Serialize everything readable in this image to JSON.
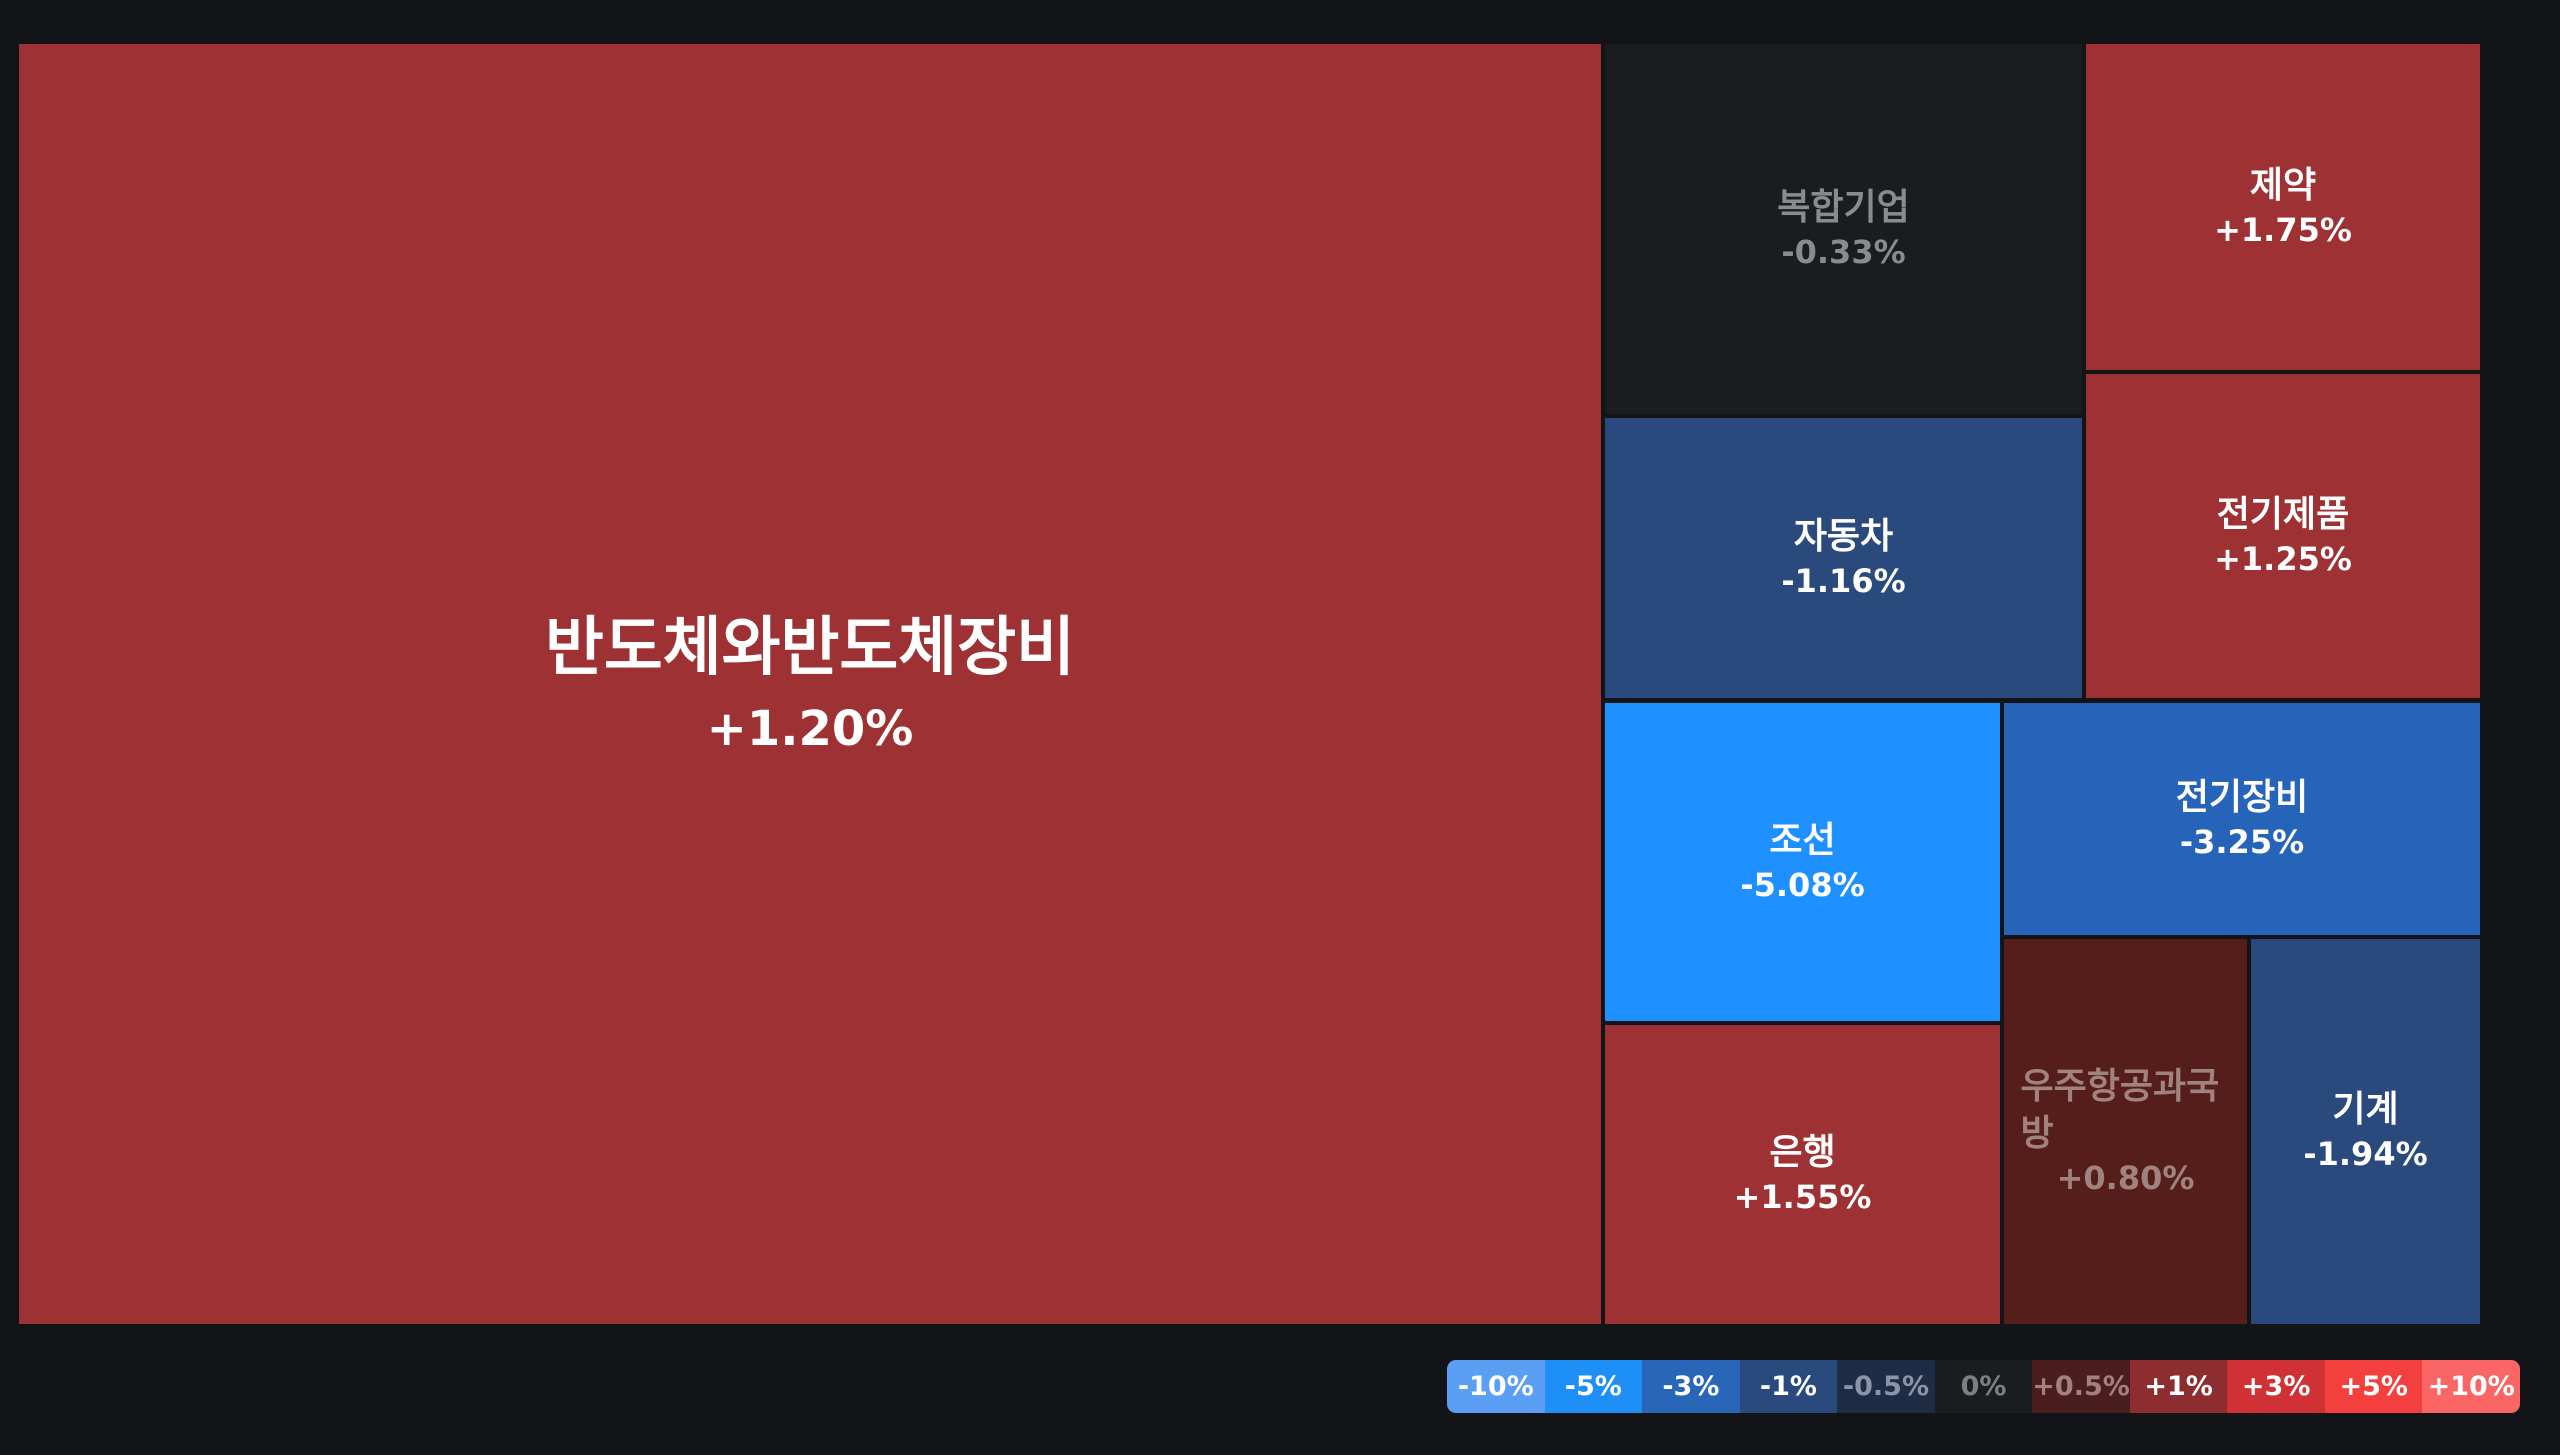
{
  "treemap": {
    "tiles": [
      {
        "name": "반도체와반도체장비",
        "change": "+1.20%",
        "bg": "#9e3133",
        "fg": "#ffffff"
      },
      {
        "name": "복합기업",
        "change": "-0.33%",
        "bg": "#1b1c1f",
        "fg": "#8a8b8e"
      },
      {
        "name": "제약",
        "change": "+1.75%",
        "bg": "#9e3133",
        "fg": "#ffffff"
      },
      {
        "name": "자동차",
        "change": "-1.16%",
        "bg": "#2a4a7e",
        "fg": "#ffffff"
      },
      {
        "name": "전기제품",
        "change": "+1.25%",
        "bg": "#9e3133",
        "fg": "#ffffff"
      },
      {
        "name": "조선",
        "change": "-5.08%",
        "bg": "#1e90ff",
        "fg": "#ffffff"
      },
      {
        "name": "전기장비",
        "change": "-3.25%",
        "bg": "#2664b9",
        "fg": "#ffffff"
      },
      {
        "name": "은행",
        "change": "+1.55%",
        "bg": "#9e3133",
        "fg": "#ffffff"
      },
      {
        "name": "우주항공과국방",
        "change": "+0.80%",
        "bg": "#561e1a",
        "fg": "#a0827f"
      },
      {
        "name": "기계",
        "change": "-1.94%",
        "bg": "#2a4a7e",
        "fg": "#ffffff"
      }
    ]
  },
  "legend": {
    "items": [
      {
        "label": "-10%",
        "bg": "#5b9ff5"
      },
      {
        "label": "-5%",
        "bg": "#1e8ff7"
      },
      {
        "label": "-3%",
        "bg": "#2966b8"
      },
      {
        "label": "-1%",
        "bg": "#2a4a7e"
      },
      {
        "label": "-0.5%",
        "bg": "#1f2c45",
        "fg": "#8b93a6"
      },
      {
        "label": "0%",
        "bg": "#1b1c1f",
        "fg": "#7d7e82"
      },
      {
        "label": "+0.5%",
        "bg": "#4a1e1e",
        "fg": "#a2807f"
      },
      {
        "label": "+1%",
        "bg": "#8e2d2f"
      },
      {
        "label": "+3%",
        "bg": "#cf3134"
      },
      {
        "label": "+5%",
        "bg": "#f43f3f"
      },
      {
        "label": "+10%",
        "bg": "#fa6565"
      }
    ]
  }
}
